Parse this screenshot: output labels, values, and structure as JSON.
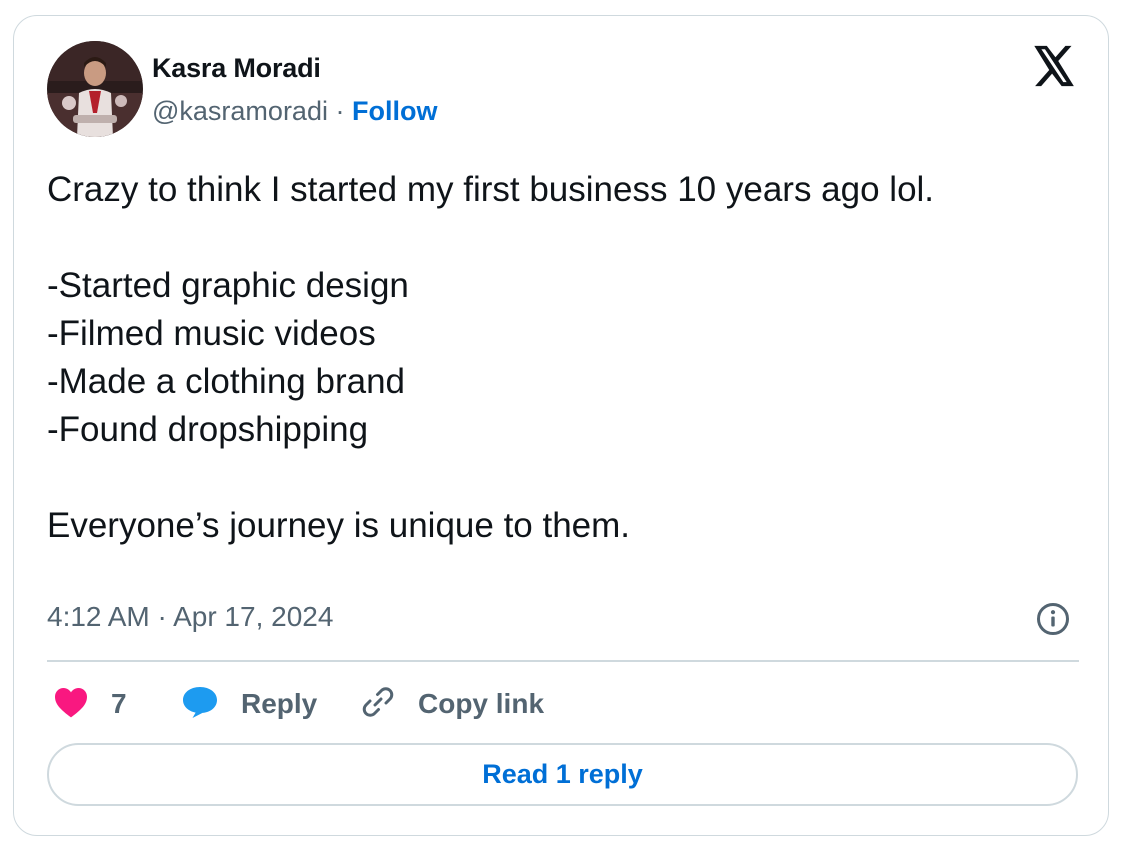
{
  "author": {
    "name": "Kasra Moradi",
    "handle": "@kasramoradi",
    "separator": "·",
    "follow_label": "Follow"
  },
  "tweet": {
    "lines": [
      "Crazy to think I started my first business 10 years ago lol.",
      "",
      "-Started graphic design",
      "-Filmed music videos",
      "-Made a clothing brand",
      "-Found dropshipping",
      "",
      "Everyone’s journey is unique to them."
    ],
    "timestamp": "4:12 AM · Apr 17, 2024"
  },
  "actions": {
    "like_count": "7",
    "reply_label": "Reply",
    "copy_link_label": "Copy link"
  },
  "read_replies_label": "Read 1 reply",
  "icons": {
    "brand": "x-logo-icon",
    "info": "info-icon",
    "like": "heart-icon",
    "reply": "speech-bubble-icon",
    "copy": "link-icon"
  },
  "colors": {
    "text": "#0f1419",
    "secondary": "#536471",
    "link": "#006fd6",
    "heart": "#f91880",
    "reply_bubble": "#1d9bf0",
    "border": "#cfd9de"
  }
}
